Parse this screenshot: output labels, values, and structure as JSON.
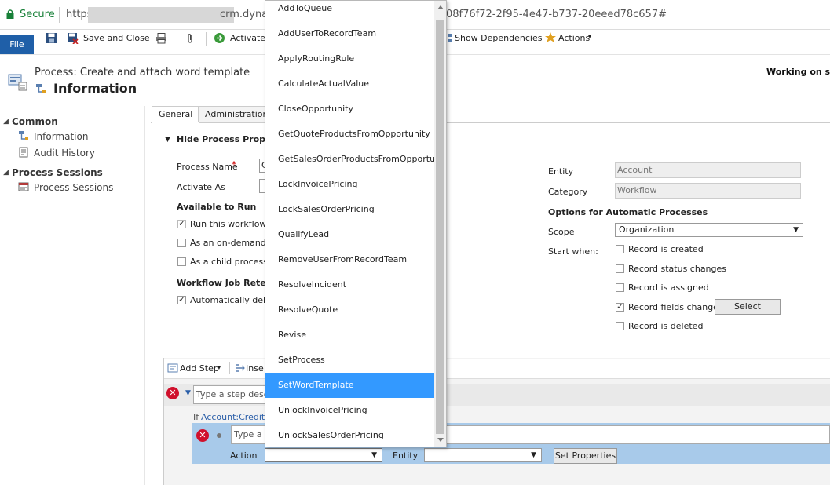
{
  "address_bar": {
    "secure_label": "Secure",
    "url_prefix": "https",
    "url_middle": "crm.dyna",
    "url_suffix": "08f76f72-2f95-4e47-b737-20eeed78c657#"
  },
  "toolbar": {
    "file_label": "File",
    "save_close_label": "Save and Close",
    "activate_label": "Activate",
    "show_dependencies_label": "Show Dependencies",
    "actions_label": "Actions"
  },
  "header": {
    "subtitle": "Process: Create and attach word template",
    "title": "Information",
    "working_on": "Working on solu"
  },
  "left_nav": {
    "common_label": "Common",
    "items_common": [
      "Information",
      "Audit History"
    ],
    "process_sessions_label": "Process Sessions",
    "items_process": [
      "Process Sessions"
    ]
  },
  "tabs": [
    "General",
    "Administration"
  ],
  "general": {
    "section_title": "Hide Process Properti",
    "process_name_label": "Process Name",
    "required_mark": "*",
    "process_name_value": "C",
    "activate_as_label": "Activate As",
    "available_to_run_label": "Available to Run",
    "run_workflow_label": "Run this workflow i",
    "on_demand_label": "As an on-demand p",
    "child_process_label": "As a child process",
    "retention_label": "Workflow Job Retenti",
    "auto_delete_label": "Automatically delet"
  },
  "right_props": {
    "entity_label": "Entity",
    "entity_value": "Account",
    "category_label": "Category",
    "category_value": "Workflow",
    "options_title": "Options for Automatic Processes",
    "scope_label": "Scope",
    "scope_value": "Organization",
    "start_when_label": "Start when:",
    "triggers": [
      {
        "label": "Record is created",
        "checked": false
      },
      {
        "label": "Record status changes",
        "checked": false
      },
      {
        "label": "Record is assigned",
        "checked": false
      },
      {
        "label": "Record fields change",
        "checked": true
      },
      {
        "label": "Record is deleted",
        "checked": false
      }
    ],
    "select_button": "Select"
  },
  "steps": {
    "add_step_label": "Add Step",
    "insert_label": "Inse",
    "step_placeholder": "Type a step descri",
    "condition_if": "If",
    "condition_text": "Account:Credit L",
    "sub_step_placeholder": "Type a s",
    "action_label": "Action",
    "entity_label": "Entity",
    "set_properties_button": "Set Properties"
  },
  "action_dropdown": {
    "items": [
      "AddToQueue",
      "AddUserToRecordTeam",
      "ApplyRoutingRule",
      "CalculateActualValue",
      "CloseOpportunity",
      "GetQuoteProductsFromOpportunity",
      "GetSalesOrderProductsFromOpportunity",
      "LockInvoicePricing",
      "LockSalesOrderPricing",
      "QualifyLead",
      "RemoveUserFromRecordTeam",
      "ResolveIncident",
      "ResolveQuote",
      "Revise",
      "SetProcess",
      "SetWordTemplate",
      "UnlockInvoicePricing",
      "UnlockSalesOrderPricing"
    ],
    "selected": "SetWordTemplate"
  },
  "colors": {
    "secure_green": "#188038",
    "file_blue": "#1f5fa8",
    "selection_blue": "#3399ff",
    "step_highlight": "#a8caea",
    "error_red": "#d0102c"
  }
}
